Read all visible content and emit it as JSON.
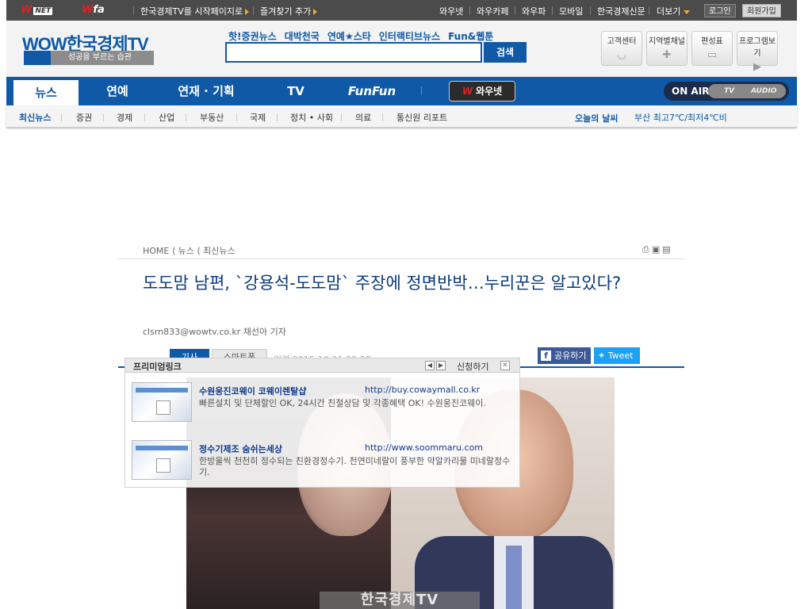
{
  "topbar": {
    "logo_wownet_w": "W",
    "logo_wownet_text": "NET",
    "logo_wowfa_w": "W",
    "logo_wowfa_text": "fa",
    "set_home": "한국경제TV를 시작페이지로",
    "bookmark": "즐겨찾기 추가",
    "links": [
      "와우넷",
      "와우카페",
      "와우파",
      "모바일",
      "한국경제신문"
    ],
    "more": "더보기",
    "login": "로그인",
    "signup": "회원가입"
  },
  "header": {
    "brand": "WOW한국경제TV",
    "tagline": "성공을 부르는 습관",
    "search_links": [
      "핫!증권뉴스",
      "대박천국",
      "연예★스타",
      "인터랙티브뉴스",
      "Fun&웹툰"
    ],
    "search_placeholder": "",
    "search_button": "검색",
    "quick": [
      {
        "label": "고객센터",
        "icon": "smile-icon",
        "glyph": "◡"
      },
      {
        "label": "지역별채널",
        "icon": "plus-icon",
        "glyph": "✚"
      },
      {
        "label": "편성표",
        "icon": "tv-schedule-icon",
        "glyph": "▭"
      },
      {
        "label": "프로그램보기",
        "icon": "play-icon",
        "glyph": "▶"
      }
    ]
  },
  "nav": {
    "items": [
      "뉴스",
      "연예",
      "연재 · 기획",
      "TV",
      "FunFun"
    ],
    "wownet": "와우넷",
    "wownet_w": "W",
    "onair": "ON AIR",
    "onair_tv": "TV",
    "onair_audio": "AUDIO"
  },
  "subnav": {
    "items": [
      "최신뉴스",
      "증권",
      "경제",
      "산업",
      "부동산",
      "국제",
      "정치 • 사회",
      "의료",
      "통신원 리포트"
    ],
    "weather_title": "오늘의 날씨",
    "weather": "부산 최고7℃/최저4℃비"
  },
  "article": {
    "breadcrumb": "HOME ⟨ 뉴스 ⟨ 최신뉴스",
    "title": "도도맘 남편, `강용석-도도맘` 주장에 정면반박…누리꾼은 알고있다?",
    "byline": "clsrn833@wowtv.co.kr 채선아 기자",
    "tab1": "기사",
    "tab2": "스마트폰",
    "date": "입력 2015-10-21 09:28",
    "facebook": "공유하기",
    "twitter": "Tweet",
    "watermark": "한국경제TV"
  },
  "premium": {
    "title": "프리미엄링크",
    "prev": "◀",
    "next": "▶",
    "apply": "신청하기",
    "close": "✕",
    "ads": [
      {
        "name": "수원웅진코웨이 코웨이렌탈샵",
        "url": "http://buy.cowaymall.co.kr",
        "desc": "빠른설치 및 단체할인 OK, 24시간 친절상담 및 각종혜택 OK! 수원웅진코웨이."
      },
      {
        "name": "정수기제조 숨쉬는세상",
        "url": "http://www.soommaru.com",
        "desc": "한방울씩 천천히 정수되는 친환경정수기. 천연미네랄이 풍부한 약알카리물 미네랄정수기."
      }
    ]
  },
  "colors": {
    "brand_blue": "#0f59a6",
    "top_bar": "#4b4b4b",
    "accent_red": "#e21f26"
  }
}
